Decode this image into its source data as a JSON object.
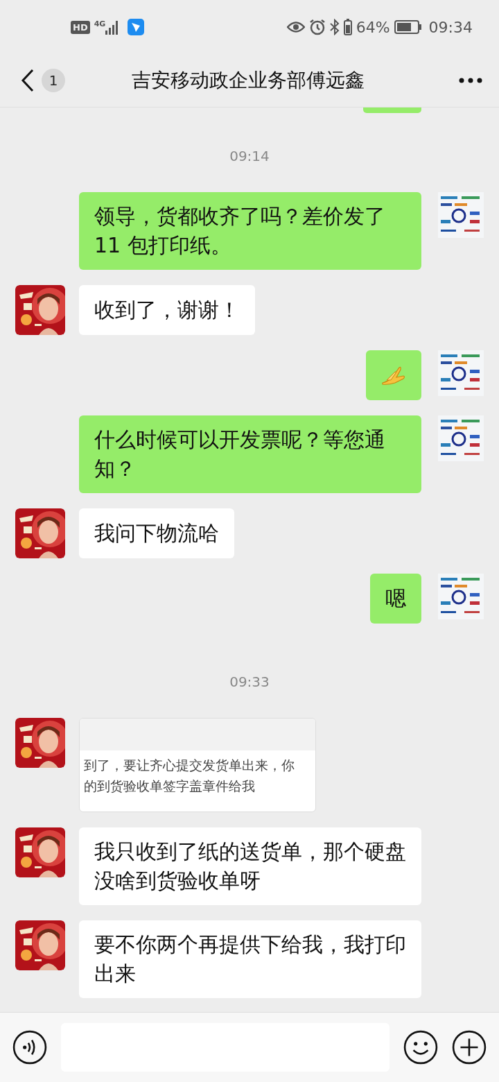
{
  "status_bar": {
    "network_badge": "HD",
    "network_type": "4G",
    "battery_percent": "64%",
    "time": "09:34"
  },
  "header": {
    "unread_count": "1",
    "title": "吉安移动政企业务部傅远鑫"
  },
  "messages": [
    {
      "kind": "clipped",
      "outgoing": true
    },
    {
      "kind": "time",
      "text": "09:14"
    },
    {
      "kind": "text",
      "outgoing": true,
      "text": "领导，货都收齐了吗？差价发了 11 包打印纸。"
    },
    {
      "kind": "text",
      "outgoing": false,
      "text": "收到了，谢谢！"
    },
    {
      "kind": "sticker",
      "outgoing": true
    },
    {
      "kind": "text",
      "outgoing": true,
      "text": "什么时候可以开发票呢？等您通知？"
    },
    {
      "kind": "text",
      "outgoing": false,
      "text": "我问下物流哈"
    },
    {
      "kind": "text",
      "outgoing": true,
      "text": "嗯"
    },
    {
      "kind": "time",
      "text": "09:33"
    },
    {
      "outgoing": false,
      "lines": [
        "到了，要让齐心提交发货单出来，你",
        "的到货验收单签字盖章件给我"
      ]
    },
    {
      "kind": "text",
      "outgoing": false,
      "text": "我只收到了纸的送货单，那个硬盘没啥到货验收单呀"
    },
    {
      "kind": "text",
      "outgoing": false,
      "text": "要不你两个再提供下给我，我打印出来"
    }
  ]
}
